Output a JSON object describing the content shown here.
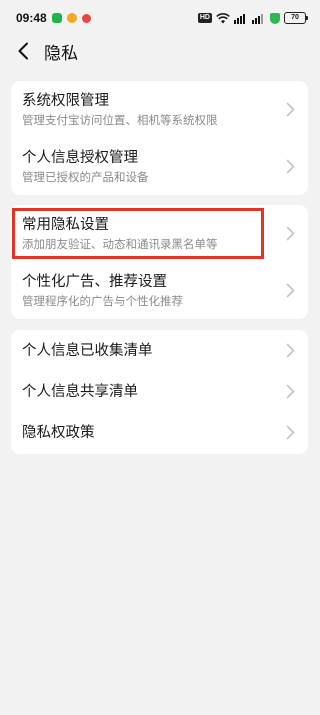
{
  "status_bar": {
    "time": "09:48",
    "hd": "HD",
    "battery": "70",
    "app_icon_colors": [
      "#1fb44b",
      "#f5a623",
      "#e8453c"
    ]
  },
  "header": {
    "title": "隐私",
    "back_icon": "chevron-left-icon"
  },
  "groups": [
    {
      "items": [
        {
          "title": "系统权限管理",
          "subtitle": "管理支付宝访问位置、相机等系统权限"
        },
        {
          "title": "个人信息授权管理",
          "subtitle": "管理已授权的产品和设备"
        }
      ]
    },
    {
      "items": [
        {
          "title": "常用隐私设置",
          "subtitle": "添加朋友验证、动态和通讯录黑名单等",
          "highlighted": true
        },
        {
          "title": "个性化广告、推荐设置",
          "subtitle": "管理程序化的广告与个性化推荐"
        }
      ]
    },
    {
      "items": [
        {
          "title": "个人信息已收集清单"
        },
        {
          "title": "个人信息共享清单"
        },
        {
          "title": "隐私权政策"
        }
      ]
    }
  ],
  "colors": {
    "background": "#f2f2f2",
    "card": "#ffffff",
    "highlight": "#e53223",
    "subtitle": "#8a8a8a",
    "chevron": "#c4c4c4"
  }
}
